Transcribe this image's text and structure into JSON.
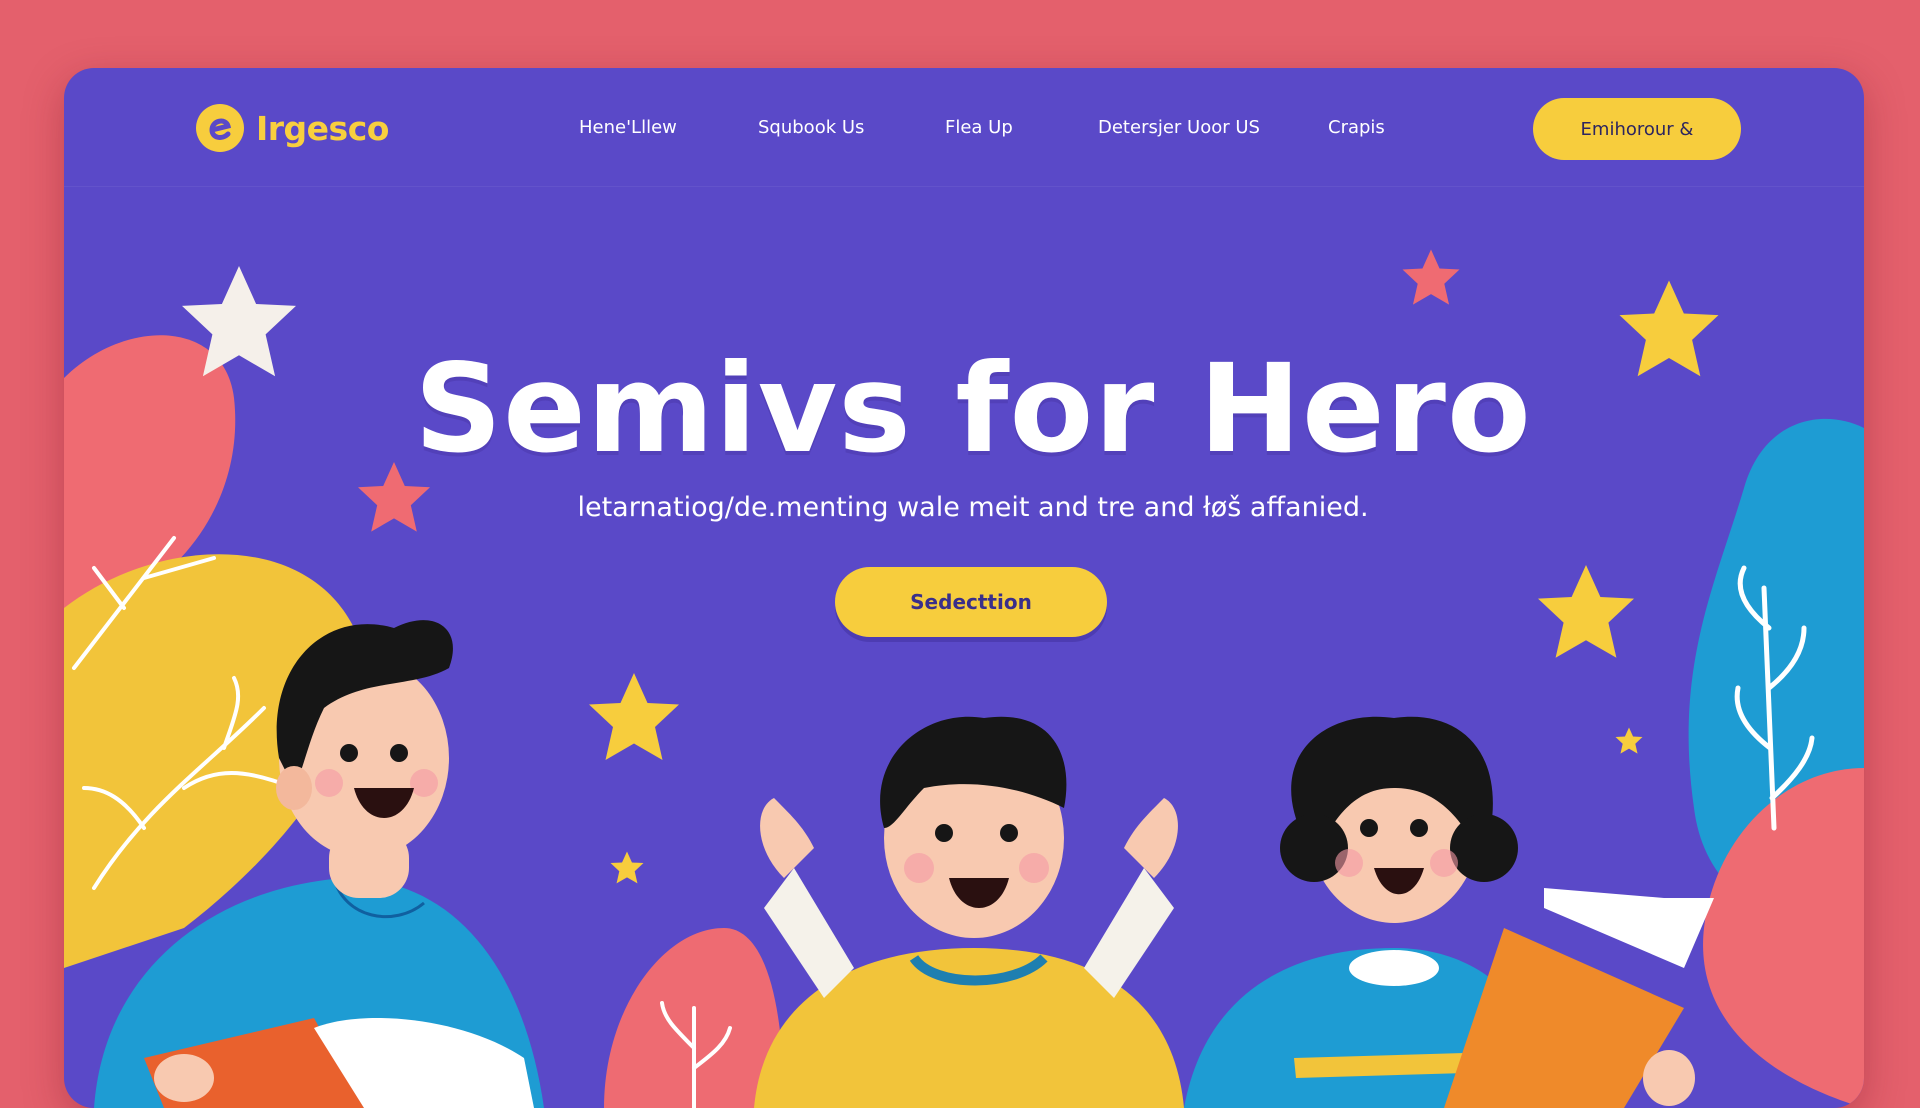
{
  "brand": {
    "name": "Irgesco"
  },
  "nav": {
    "items": [
      "Hene'Lllew",
      "Squbook Us",
      "Flea Up",
      "Detersjer Uoor US",
      "Crapis"
    ]
  },
  "header_cta": {
    "label": "Emihorour &"
  },
  "hero": {
    "title": "Semivs for Hero",
    "subtitle": "letarnatiog/de.menting wale meit and tre and łøš affanied.",
    "button_label": "Sedecttion"
  },
  "colors": {
    "page_background": "#e4606c",
    "panel": "#5a49c8",
    "accent_yellow": "#f7cd3d",
    "blue": "#1e9cd3",
    "coral": "#ee6b72",
    "orange": "#ef8a2a"
  },
  "icons": [
    "logo-mark-icon",
    "star-icon",
    "leaf-icon"
  ]
}
